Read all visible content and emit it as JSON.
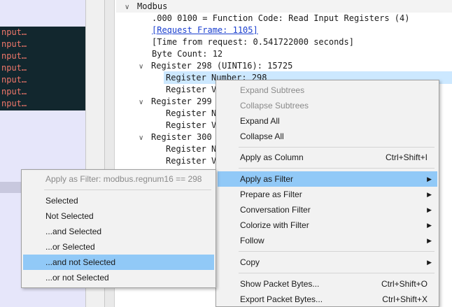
{
  "left_pane": {
    "rows": [
      "nput…",
      "nput…",
      "nput…",
      "nput…",
      "nput…",
      "nput…",
      "nput…"
    ]
  },
  "tree": {
    "header": "Modbus",
    "lines": [
      {
        "text": ".000 0100 = Function Code: Read Input Registers (4)"
      },
      {
        "text": "[Request Frame: 1105]"
      },
      {
        "text": "[Time from request: 0.541722000 seconds]"
      },
      {
        "text": "Byte Count: 12"
      },
      {
        "text": "Register 298 (UINT16): 15725"
      },
      {
        "text": "Register Number: 298"
      },
      {
        "text": "Register V"
      },
      {
        "text": "Register 299"
      },
      {
        "text": "Register N"
      },
      {
        "text": "Register V"
      },
      {
        "text": "Register 300"
      },
      {
        "text": "Register N"
      },
      {
        "text": "Register V"
      }
    ]
  },
  "context_menu": {
    "items": [
      {
        "label": "Expand Subtrees",
        "disabled": true
      },
      {
        "label": "Collapse Subtrees",
        "disabled": true
      },
      {
        "label": "Expand All"
      },
      {
        "label": "Collapse All"
      },
      {
        "label": "Apply as Column",
        "shortcut": "Ctrl+Shift+I"
      },
      {
        "label": "Apply as Filter",
        "submenu": true
      },
      {
        "label": "Prepare as Filter",
        "submenu": true
      },
      {
        "label": "Conversation Filter",
        "submenu": true
      },
      {
        "label": "Colorize with Filter",
        "submenu": true
      },
      {
        "label": "Follow",
        "submenu": true
      },
      {
        "label": "Copy",
        "submenu": true
      },
      {
        "label": "Show Packet Bytes...",
        "shortcut": "Ctrl+Shift+O"
      },
      {
        "label": "Export Packet Bytes...",
        "shortcut": "Ctrl+Shift+X"
      }
    ]
  },
  "filter_submenu": {
    "header": "Apply as Filter: modbus.regnum16 == 298",
    "items": [
      {
        "label": "Selected"
      },
      {
        "label": "Not Selected"
      },
      {
        "label": "...and Selected"
      },
      {
        "label": "...or Selected"
      },
      {
        "label": "...and not Selected"
      },
      {
        "label": "...or not Selected"
      }
    ]
  },
  "colors": {
    "highlight": "#91c9f7",
    "tree_selection": "#cce8ff",
    "packet_text": "#f0776a",
    "packet_bg": "#12272e"
  }
}
